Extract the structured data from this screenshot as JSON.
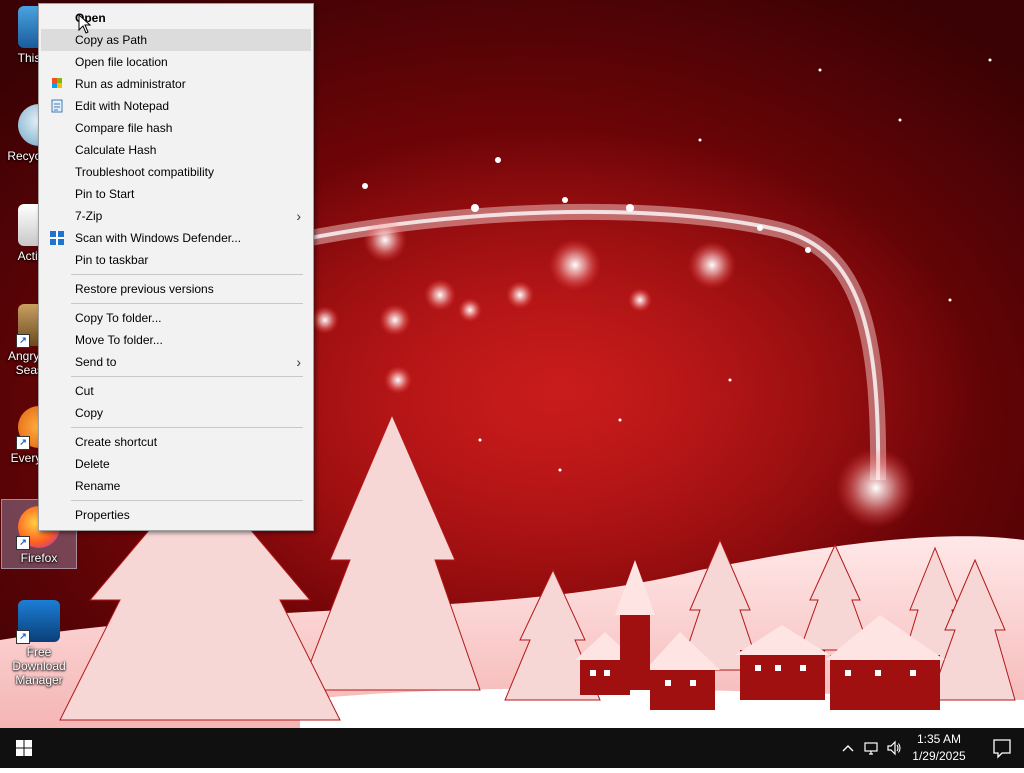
{
  "desktop": {
    "icons": [
      {
        "label": "This PC",
        "name": "this-pc"
      },
      {
        "label": "Recycle Bin",
        "name": "recycle-bin"
      },
      {
        "label": "Activate",
        "name": "activate"
      },
      {
        "label": "Angry Birds Seasons",
        "name": "angry-birds"
      },
      {
        "label": "Everything",
        "name": "everything"
      },
      {
        "label": "Firefox",
        "name": "firefox"
      },
      {
        "label": "Free Download Manager",
        "name": "free-download-manager"
      }
    ]
  },
  "context_menu": {
    "items": [
      {
        "label": "Open",
        "bold": true
      },
      {
        "label": "Copy as Path",
        "hover": true
      },
      {
        "label": "Open file location"
      },
      {
        "label": "Run as administrator",
        "icon": "shield-icon"
      },
      {
        "label": "Edit with Notepad",
        "icon": "notepad-icon"
      },
      {
        "label": "Compare file hash"
      },
      {
        "label": "Calculate Hash"
      },
      {
        "label": "Troubleshoot compatibility"
      },
      {
        "label": "Pin to Start"
      },
      {
        "label": "7-Zip",
        "submenu": true
      },
      {
        "label": "Scan with Windows Defender...",
        "icon": "defender-icon"
      },
      {
        "label": "Pin to taskbar"
      },
      {
        "separator": true
      },
      {
        "label": "Restore previous versions"
      },
      {
        "separator": true
      },
      {
        "label": "Copy To folder..."
      },
      {
        "label": "Move To folder..."
      },
      {
        "label": "Send to",
        "submenu": true
      },
      {
        "separator": true
      },
      {
        "label": "Cut"
      },
      {
        "label": "Copy"
      },
      {
        "separator": true
      },
      {
        "label": "Create shortcut"
      },
      {
        "label": "Delete"
      },
      {
        "label": "Rename"
      },
      {
        "separator": true
      },
      {
        "label": "Properties"
      }
    ]
  },
  "taskbar": {
    "time": "1:35 AM",
    "date": "1/29/2025"
  }
}
